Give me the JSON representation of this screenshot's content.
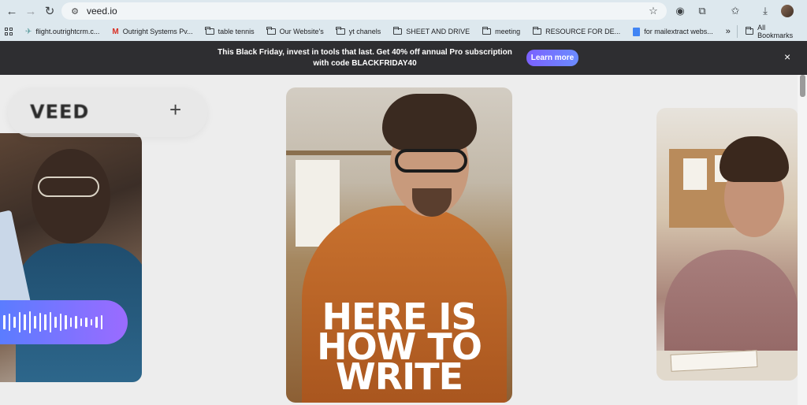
{
  "browser": {
    "url": "veed.io",
    "bookmarks": [
      {
        "label": "flight.outrightcrm.c...",
        "icon": "bird-icon"
      },
      {
        "label": "Outright Systems Pv...",
        "icon": "gmail-icon"
      },
      {
        "label": "table tennis",
        "icon": "folder-icon"
      },
      {
        "label": "Our Website's",
        "icon": "folder-icon"
      },
      {
        "label": "yt chanels",
        "icon": "folder-icon"
      },
      {
        "label": "SHEET AND DRIVE",
        "icon": "folder-icon"
      },
      {
        "label": "meeting",
        "icon": "folder-icon"
      },
      {
        "label": "RESOURCE FOR DE...",
        "icon": "folder-icon"
      },
      {
        "label": "for mailextract webs...",
        "icon": "doc-icon"
      }
    ],
    "more_bookmarks": "»",
    "all_bookmarks": "All Bookmarks"
  },
  "promo": {
    "text": "This Black Friday, invest in tools that last. Get 40% off annual Pro subscription with code BLACKFRIDAY40",
    "button": "Learn more",
    "close": "×"
  },
  "logo": {
    "text": "VEED",
    "plus": "+"
  },
  "hero": {
    "headline": [
      "HERE IS",
      "HOW TO",
      "WRITE"
    ]
  },
  "audio_bars": [
    18,
    22,
    14,
    26,
    20,
    28,
    16,
    24,
    20,
    26,
    14,
    22,
    18,
    12,
    16,
    10,
    12,
    8,
    14,
    18
  ]
}
